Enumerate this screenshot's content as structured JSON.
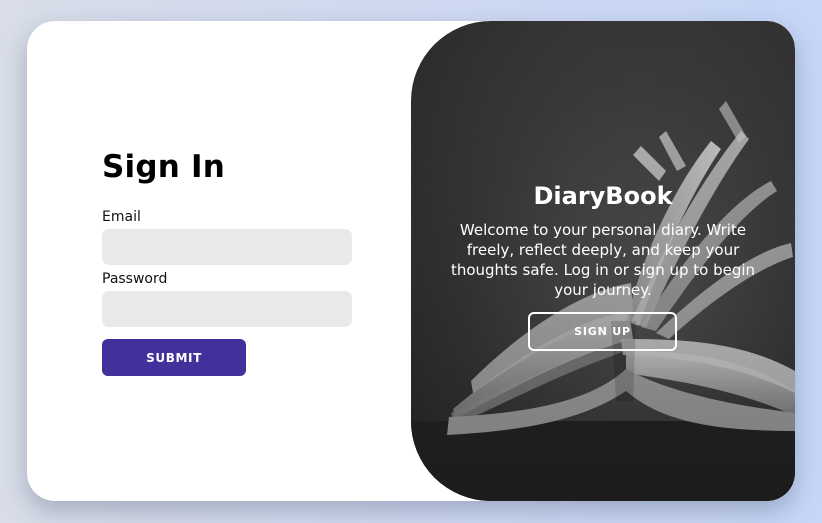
{
  "signin": {
    "title": "Sign In",
    "email_label": "Email",
    "password_label": "Password",
    "submit_label": "SUBMIT"
  },
  "panel": {
    "brand": "DiaryBook",
    "message": "Welcome to your personal diary. Write freely, reflect deeply, and keep your thoughts safe. Log in or sign up to begin your journey.",
    "signup_label": "SIGN UP",
    "image": "open-book-photo"
  },
  "colors": {
    "accent": "#43309a",
    "panel": "#3c3c3c",
    "field": "#e9e9e9"
  }
}
